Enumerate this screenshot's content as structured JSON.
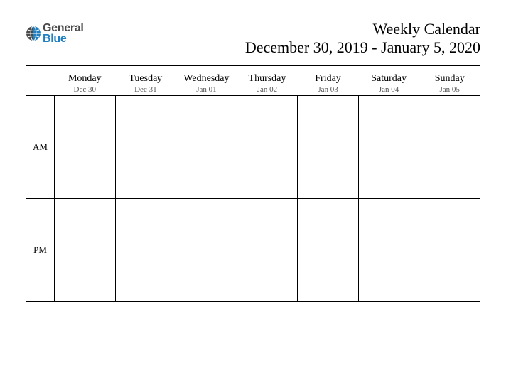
{
  "logo": {
    "word1": "General",
    "word2": "Blue"
  },
  "header": {
    "title": "Weekly Calendar",
    "subtitle": "December 30, 2019 - January 5, 2020"
  },
  "calendar": {
    "rows": [
      {
        "label": "AM"
      },
      {
        "label": "PM"
      }
    ],
    "days": [
      {
        "dow": "Monday",
        "date": "Dec 30"
      },
      {
        "dow": "Tuesday",
        "date": "Dec 31"
      },
      {
        "dow": "Wednesday",
        "date": "Jan 01"
      },
      {
        "dow": "Thursday",
        "date": "Jan 02"
      },
      {
        "dow": "Friday",
        "date": "Jan 03"
      },
      {
        "dow": "Saturday",
        "date": "Jan 04"
      },
      {
        "dow": "Sunday",
        "date": "Jan 05"
      }
    ]
  }
}
